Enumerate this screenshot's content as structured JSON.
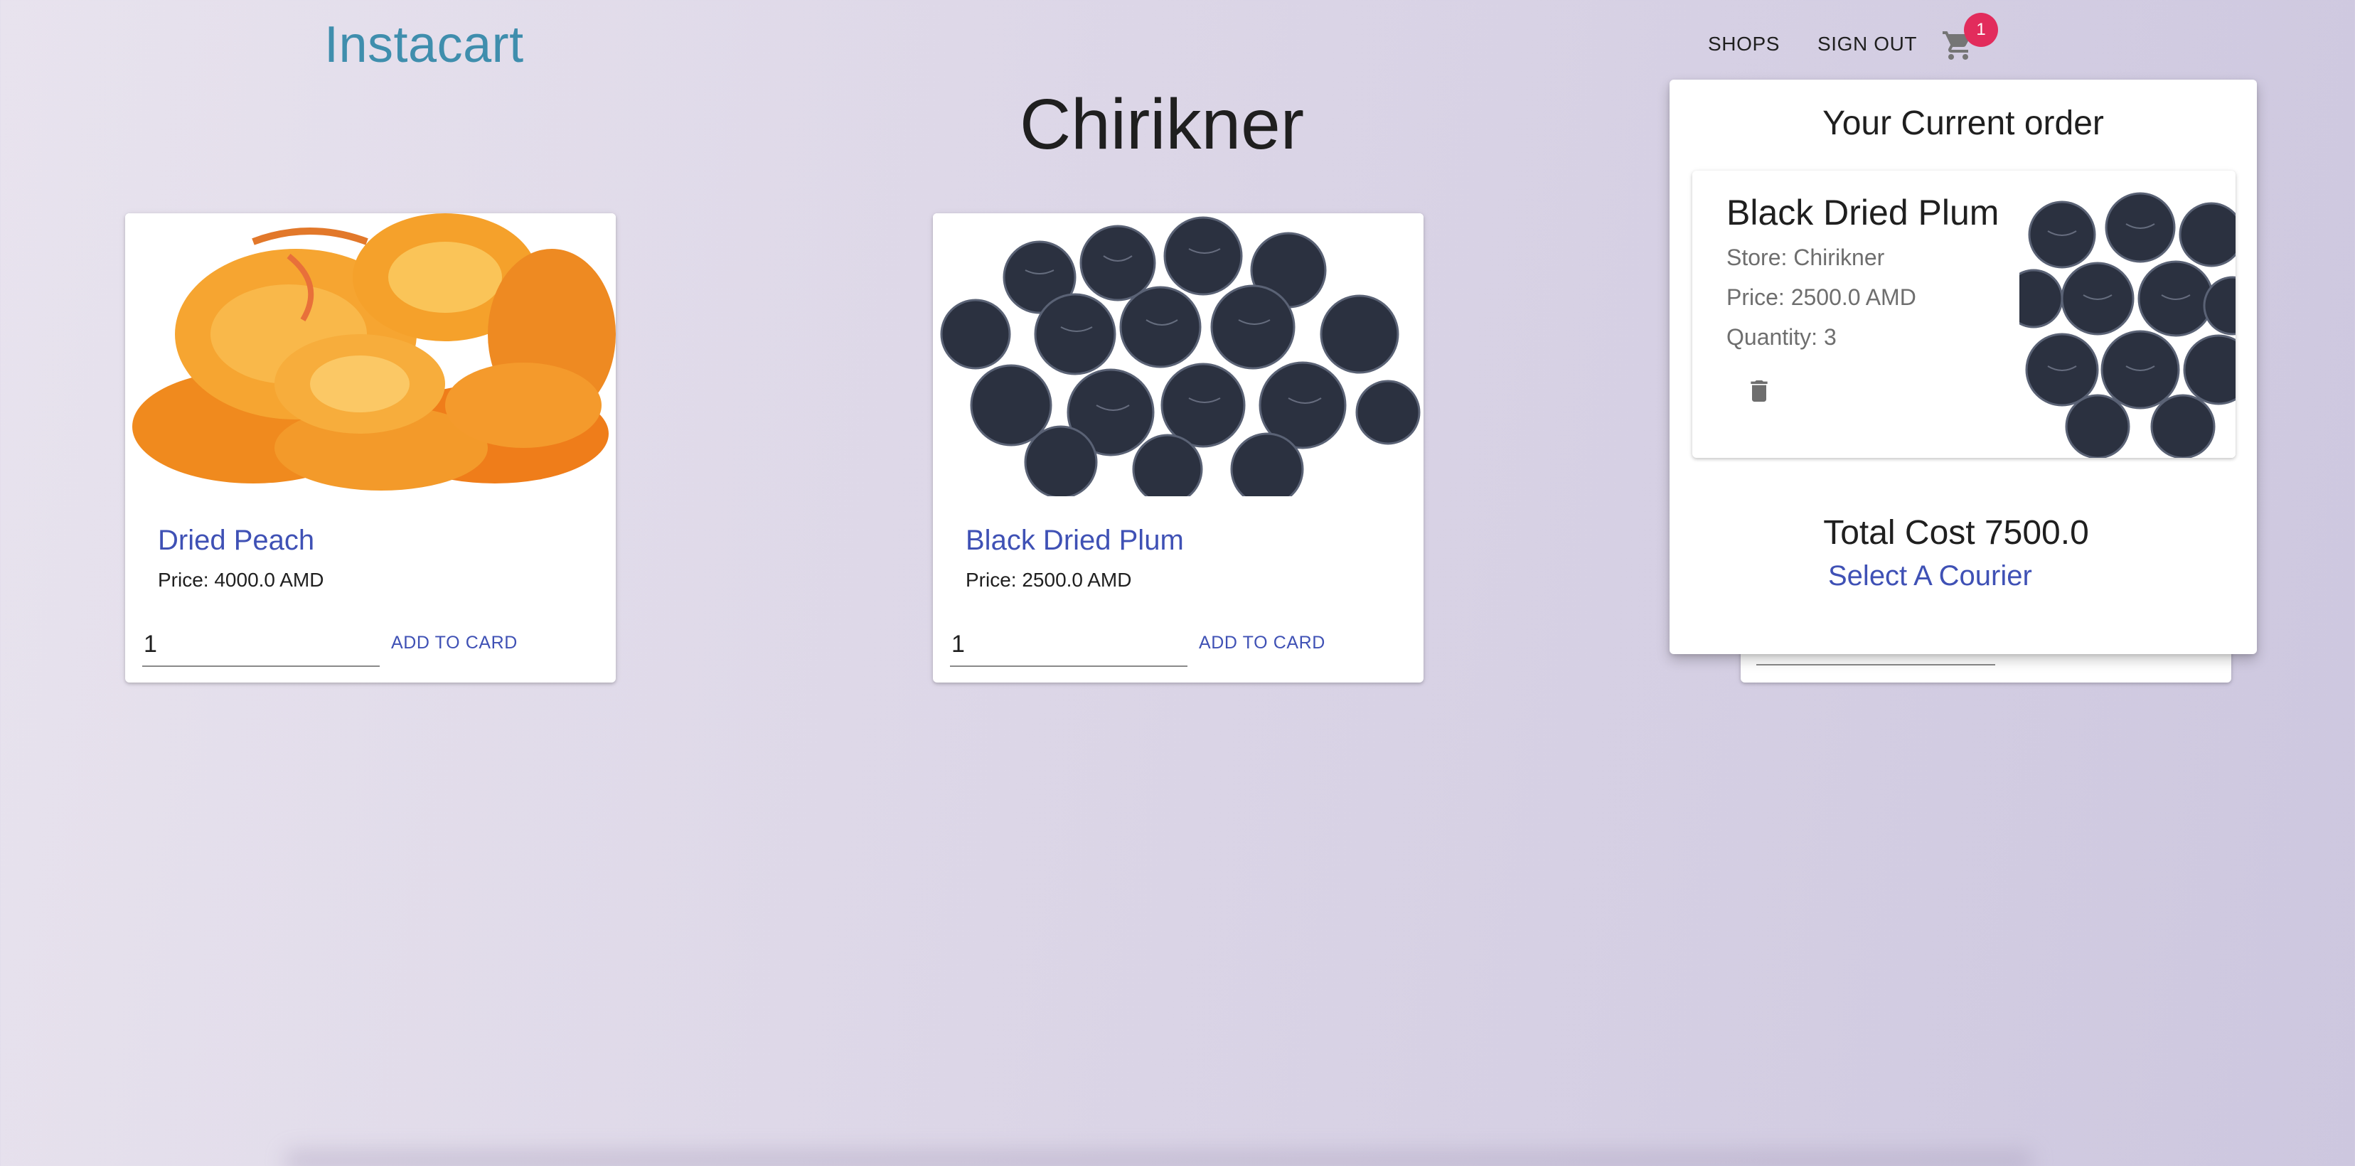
{
  "header": {
    "brand": "Instacart",
    "nav": {
      "shops_label": "SHOPS",
      "sign_out_label": "SIGN OUT"
    },
    "cart": {
      "icon": "shopping-cart-icon",
      "badge_count": "1"
    }
  },
  "page": {
    "title": "Chirikner"
  },
  "products": [
    {
      "name": "Dried Peach",
      "price": "Price: 4000.0 AMD",
      "quantity_value": "1",
      "add_button_label": "ADD TO CARD"
    },
    {
      "name": "Black Dried Plum",
      "price": "Price: 2500.0 AMD",
      "quantity_value": "1",
      "add_button_label": "ADD TO CARD"
    }
  ],
  "order": {
    "title": "Your Current order",
    "item": {
      "name": "Black Dried Plum",
      "store": "Store: Chirikner",
      "price": "Price: 2500.0 AMD",
      "quantity": "Quantity: 3",
      "delete_icon": "trash-icon"
    },
    "total": "Total Cost 7500.0",
    "courier_link": "Select A Courier"
  },
  "colors": {
    "brand": "#3f8ead",
    "link": "#3f51b5",
    "badge": "#e22c5c"
  }
}
